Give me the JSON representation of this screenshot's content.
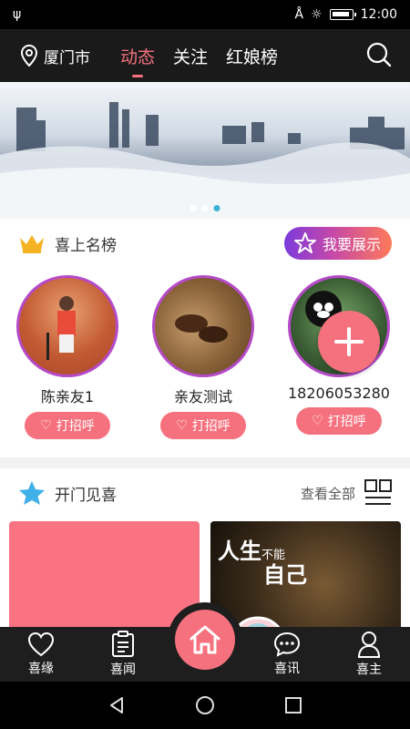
{
  "status_bar": {
    "time": "12:00"
  },
  "header": {
    "location": "厦门市",
    "tabs": [
      {
        "label": "动态",
        "active": true
      },
      {
        "label": "关注",
        "active": false
      },
      {
        "label": "红娘榜",
        "active": false
      }
    ]
  },
  "banner": {
    "dots": 3,
    "active_dot": 3
  },
  "ranking": {
    "title": "喜上名榜",
    "show_button": "我要展示",
    "friends": [
      {
        "name": "陈亲友1",
        "button": "打招呼"
      },
      {
        "name": "亲友测试",
        "button": "打招呼"
      },
      {
        "name": "18206053280",
        "button": "打招呼"
      }
    ]
  },
  "meet": {
    "title": "开门见喜",
    "see_all": "查看全部",
    "card2_poster": {
      "line1": "人生",
      "line2": "不能",
      "line3": "自己"
    }
  },
  "bottom_nav": {
    "items": [
      {
        "label": "喜缘"
      },
      {
        "label": "喜闻"
      },
      {
        "label": "喜讯"
      },
      {
        "label": "喜主"
      }
    ]
  },
  "colors": {
    "accent": "#f6717e",
    "header_bg": "#1a1a1a",
    "avatar_border": "#b54ac8",
    "dot_active": "#3ab0d6"
  }
}
